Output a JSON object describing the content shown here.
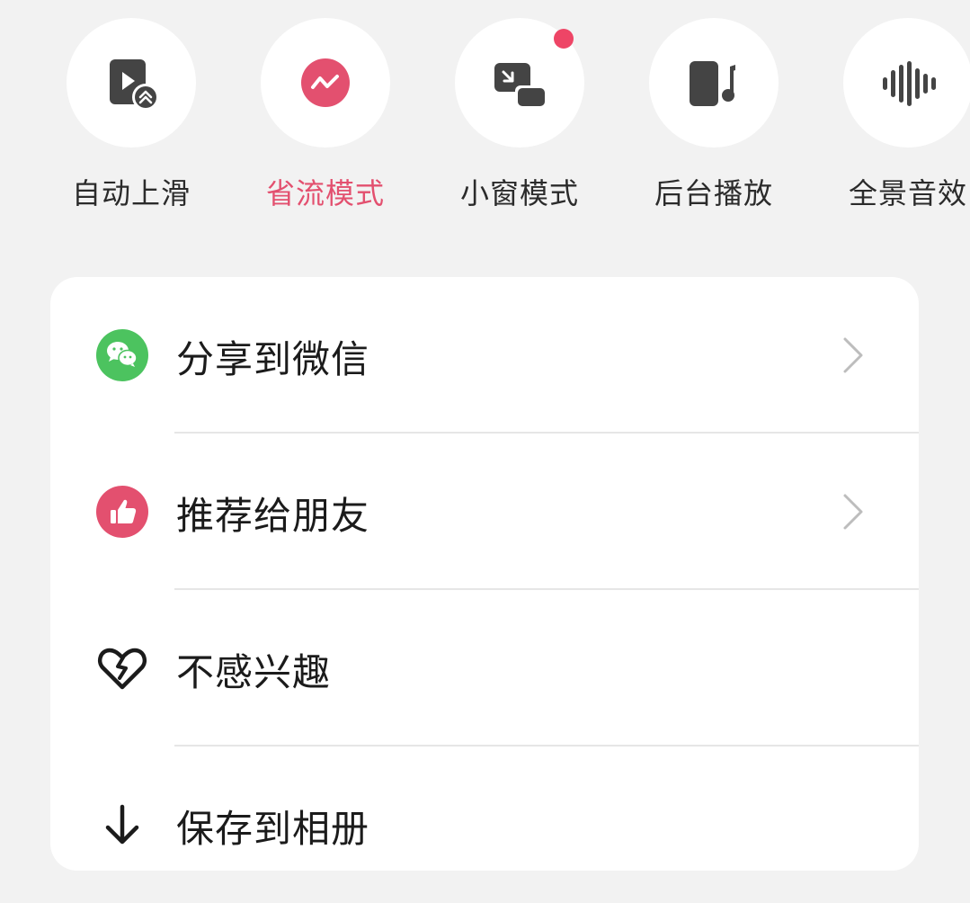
{
  "quick_actions": [
    {
      "label": "自动上滑",
      "icon": "auto-swipe-up-icon",
      "active": false,
      "badge": false
    },
    {
      "label": "省流模式",
      "icon": "data-saver-icon",
      "active": true,
      "badge": false
    },
    {
      "label": "小窗模式",
      "icon": "picture-in-picture-icon",
      "active": false,
      "badge": true
    },
    {
      "label": "后台播放",
      "icon": "background-play-icon",
      "active": false,
      "badge": false
    },
    {
      "label": "全景音效",
      "icon": "audio-wave-icon",
      "active": false,
      "badge": false
    }
  ],
  "menu": {
    "items": [
      {
        "label": "分享到微信",
        "icon": "wechat-icon",
        "has_chevron": true
      },
      {
        "label": "推荐给朋友",
        "icon": "thumbs-up-icon",
        "has_chevron": true
      },
      {
        "label": "不感兴趣",
        "icon": "broken-heart-icon",
        "has_chevron": false
      },
      {
        "label": "保存到相册",
        "icon": "download-arrow-icon",
        "has_chevron": false
      }
    ]
  },
  "colors": {
    "background": "#f2f2f2",
    "accent": "#e3506f",
    "badge": "#ee4566",
    "wechat_green": "#4cc35f",
    "icon_dark": "#444444"
  }
}
